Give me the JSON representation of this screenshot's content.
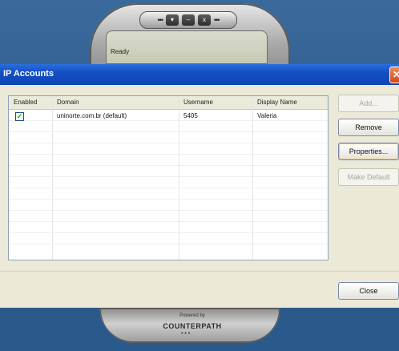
{
  "phone": {
    "status": "Ready",
    "buttons": [
      "▾",
      "–",
      "x"
    ],
    "dots_left": "•••",
    "dots_right": "•••",
    "powered_by": "Powered by",
    "brand": "COUNTERPATH",
    "brand_dots": "• • •"
  },
  "dialog": {
    "title": "IP Accounts",
    "close_glyph": "✕",
    "columns": [
      "Enabled",
      "Domain",
      "Username",
      "Display Name"
    ],
    "rows": [
      {
        "enabled": true,
        "check": "✓",
        "domain": "uninorte.com.br (default)",
        "username": "5405",
        "display_name": "Valeria"
      }
    ],
    "buttons": {
      "add": "Add...",
      "remove": "Remove",
      "properties": "Properties...",
      "make_default": "Make Default",
      "close": "Close"
    }
  }
}
